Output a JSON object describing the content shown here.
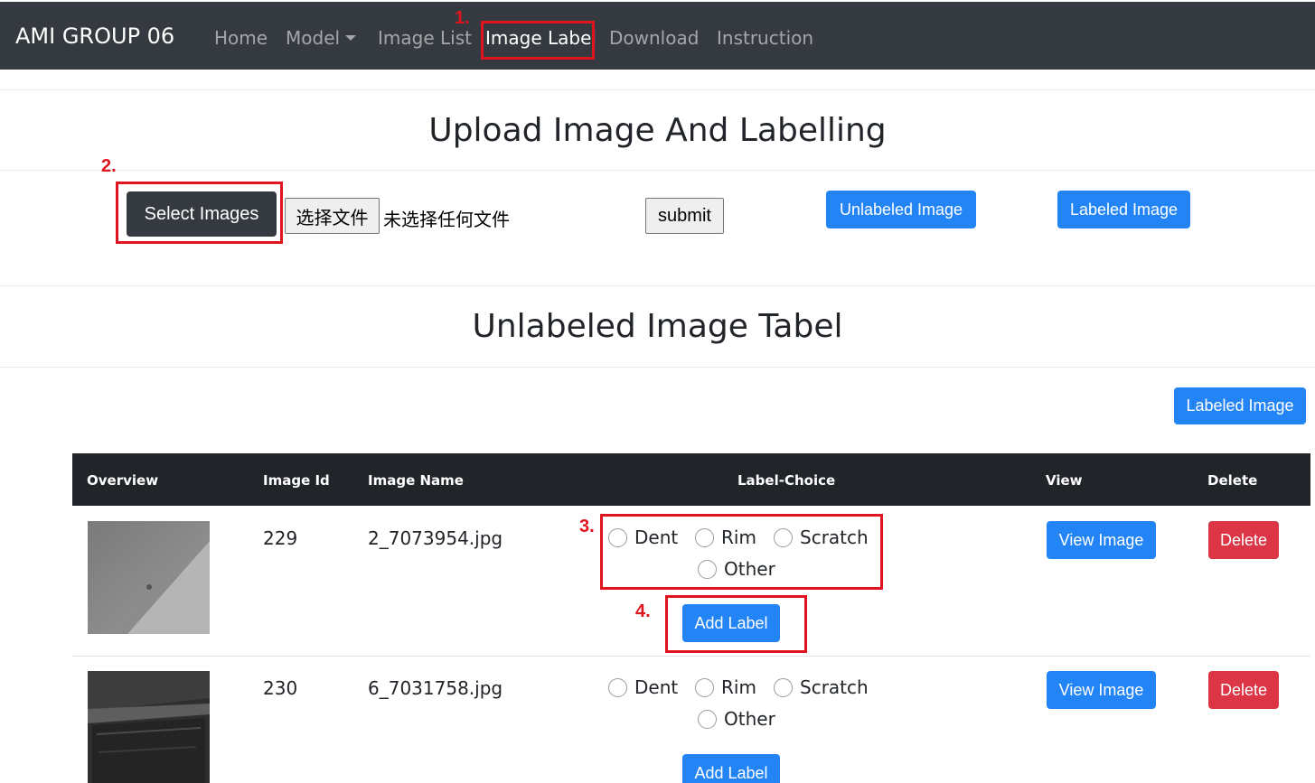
{
  "navbar": {
    "brand": "AMI GROUP 06",
    "items": [
      {
        "label": "Home"
      },
      {
        "label": "Model"
      },
      {
        "label": "Image List"
      },
      {
        "label": "Image Label"
      },
      {
        "label": "Download"
      },
      {
        "label": "Instruction"
      }
    ],
    "active": "Image Label"
  },
  "annotations": [
    "1.",
    "2.",
    "3.",
    "4."
  ],
  "upload": {
    "title": "Upload Image And Labelling",
    "select_label": "Select Images",
    "file_button": "选择文件",
    "file_status": "未选择任何文件",
    "submit": "submit",
    "unlabeled_button": "Unlabeled Image",
    "labeled_button": "Labeled Image"
  },
  "table_section": {
    "title": "Unlabeled Image Tabel",
    "labeled_button": "Labeled Image",
    "headers": [
      "Overview",
      "Image Id",
      "Image Name",
      "Label-Choice",
      "View",
      "Delete"
    ],
    "label_options": [
      "Dent",
      "Rim",
      "Scratch",
      "Other"
    ],
    "add_label": "Add Label",
    "view_label": "View Image",
    "delete_label": "Delete",
    "rows": [
      {
        "id": "229",
        "name": "2_7073954.jpg"
      },
      {
        "id": "230",
        "name": "6_7031758.jpg"
      }
    ]
  },
  "colors": {
    "navbar": "#343a40",
    "primary": "#2385f5",
    "danger": "#dc3545",
    "annotation": "#e0141e",
    "table_header": "#212529"
  }
}
